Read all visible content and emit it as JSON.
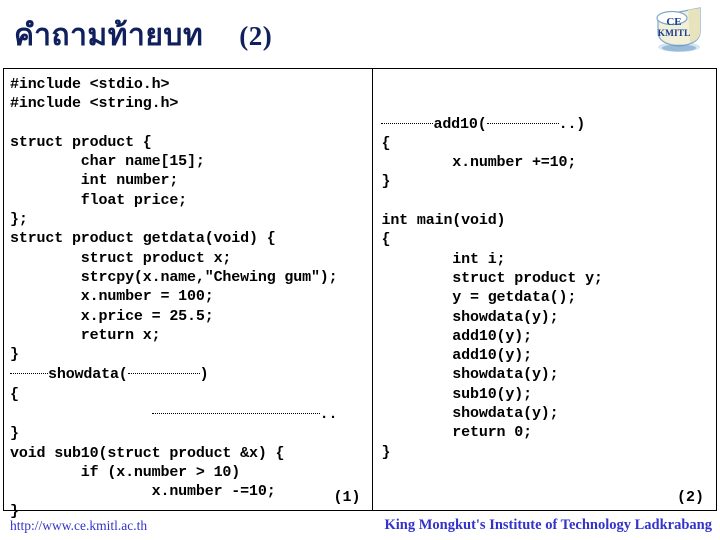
{
  "header": {
    "title_thai": "คำถามท้ายบท",
    "title_number": "(2)",
    "logo_line1": "CE",
    "logo_line2": "KMITL",
    "title_color": "#10205c"
  },
  "code": {
    "left_column": [
      "#include <stdio.h>",
      "#include <string.h>",
      "",
      "struct product {",
      "        char name[15];",
      "        int number;",
      "        float price;",
      "};",
      "struct product getdata(void) {",
      "        struct product x;",
      "        strcpy(x.name,\"Chewing gum\");",
      "        x.number = 100;",
      "        x.price = 25.5;",
      "        return x;",
      "}",
      "BLANK_SHOWDATA_SIGNATURE",
      "{",
      "BLANK_BODY_LINE",
      "}",
      "void sub10(struct product &x) {",
      "        if (x.number > 10)",
      "                x.number -=10;",
      "}"
    ],
    "left_blank_showdata": {
      "prefix_blank": "..........",
      "name": "showdata(",
      "arg_blank": "................",
      "suffix": ")"
    },
    "left_blank_body": {
      "blank": "..................................",
      "suffix": ".."
    },
    "right_column": [
      "",
      "",
      "BLANK_ADD10_SIGNATURE",
      "{",
      "        x.number +=10;",
      "}",
      "",
      "int main(void)",
      "{",
      "        int i;",
      "        struct product y;",
      "        y = getdata();",
      "        showdata(y);",
      "        add10(y);",
      "        add10(y);",
      "        showdata(y);",
      "        sub10(y);",
      "        showdata(y);",
      "        return 0;",
      "}"
    ],
    "right_blank_add10": {
      "prefix_blank": "............",
      "name": "add10(",
      "arg_blank": "...............",
      "suffix": "..)"
    },
    "left_page_marker": "(1)",
    "right_page_marker": "(2)"
  },
  "footer": {
    "url": "http://www.ce.kmitl.ac.th",
    "institute": "King Mongkut's Institute of Technology Ladkrabang",
    "color": "#3333cc"
  }
}
